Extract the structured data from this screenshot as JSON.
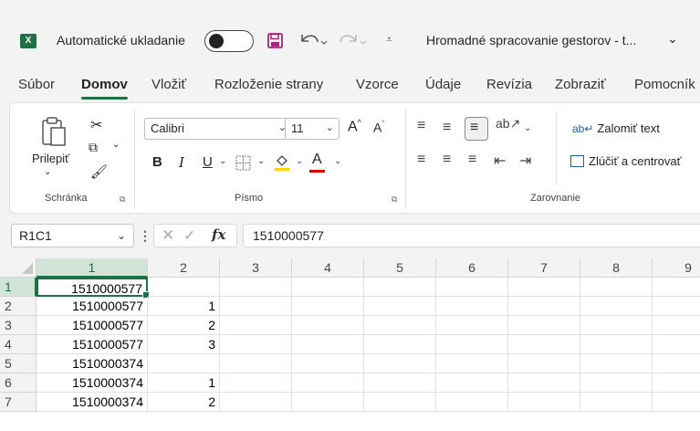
{
  "titlebar": {
    "app_icon": "X",
    "autosave_label": "Automatické ukladanie",
    "doc_title": "Hromadné spracovanie gestorov - t...",
    "icons": [
      "excel-icon",
      "save-icon",
      "undo-icon",
      "redo-icon",
      "customize-qat-icon",
      "chevron-down-icon"
    ]
  },
  "tabs": [
    "Súbor",
    "Domov",
    "Vložiť",
    "Rozloženie strany",
    "Vzorce",
    "Údaje",
    "Revízia",
    "Zobraziť",
    "Pomocník"
  ],
  "active_tab": "Domov",
  "ribbon": {
    "clipboard": {
      "paste_label": "Prilepiť",
      "group_label": "Schránka"
    },
    "font": {
      "font_name": "Calibri",
      "font_size": "11",
      "group_label": "Písmo",
      "bold": "B",
      "italic": "I",
      "underline": "U"
    },
    "alignment": {
      "wrap_label": "Zalomiť text",
      "merge_label": "Zlúčiť a centrovať",
      "group_label": "Zarovnanie"
    }
  },
  "formula_bar": {
    "name_box": "R1C1",
    "fx": "fx",
    "value": "1510000577"
  },
  "grid": {
    "columns": [
      "1",
      "2",
      "3",
      "4",
      "5",
      "6",
      "7",
      "8",
      "9"
    ],
    "rows": [
      {
        "num": "1",
        "c1": "1510000577",
        "c2": ""
      },
      {
        "num": "2",
        "c1": "1510000577",
        "c2": "1"
      },
      {
        "num": "3",
        "c1": "1510000577",
        "c2": "2"
      },
      {
        "num": "4",
        "c1": "1510000577",
        "c2": "3"
      },
      {
        "num": "5",
        "c1": "1510000374",
        "c2": ""
      },
      {
        "num": "6",
        "c1": "1510000374",
        "c2": "1"
      },
      {
        "num": "7",
        "c1": "1510000374",
        "c2": "2"
      }
    ]
  },
  "colors": {
    "accent": "#1e7145",
    "selected_header": "#d2e3d8"
  }
}
